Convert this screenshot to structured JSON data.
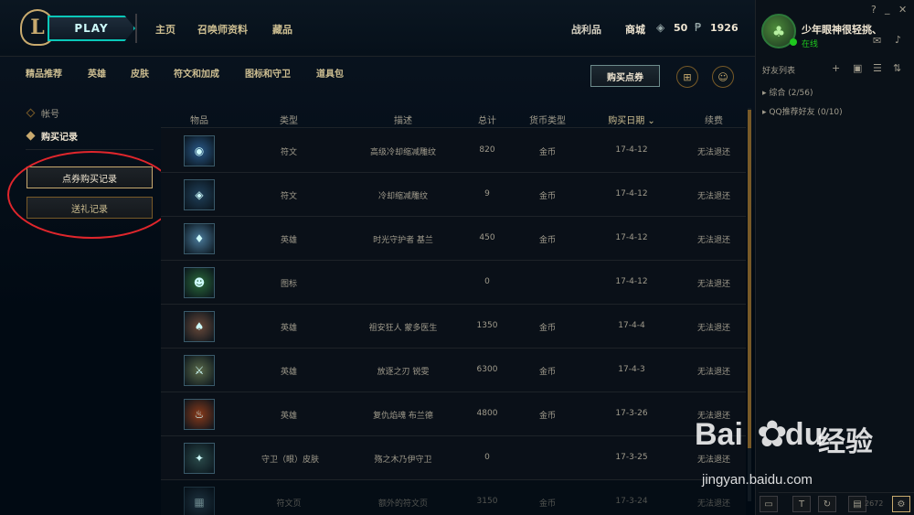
{
  "topbar": {
    "logo": "L",
    "play": "PLAY",
    "nav": [
      "主页",
      "召唤师资料",
      "藏品"
    ],
    "right_nav": [
      "战利品",
      "商城"
    ],
    "be_amount": "50",
    "rp_amount": "1926"
  },
  "subnav": [
    "精品推荐",
    "英雄",
    "皮肤",
    "符文和加成",
    "图标和守卫",
    "道具包"
  ],
  "buy_rp": "购买点券",
  "sidebar": {
    "items": [
      "帐号",
      "购买记录"
    ],
    "buttons": [
      "点券购买记录",
      "送礼记录"
    ]
  },
  "table": {
    "headers": [
      "物品",
      "类型",
      "描述",
      "总计",
      "货币类型",
      "购买日期",
      "续费"
    ],
    "sort_icon": "chevron-down-icon",
    "rows": [
      {
        "type": "符文",
        "desc": "高级冷却缩减雕纹",
        "total": "820",
        "currency": "金币",
        "date": "17-4-12",
        "refund": "无法退还",
        "thumb_color": "#2a5a8a"
      },
      {
        "type": "符文",
        "desc": "冷却缩减雕纹",
        "total": "9",
        "currency": "金币",
        "date": "17-4-12",
        "refund": "无法退还",
        "thumb_color": "#20405a"
      },
      {
        "type": "英雄",
        "desc": "时光守护者 基兰",
        "total": "450",
        "currency": "金币",
        "date": "17-4-12",
        "refund": "无法退还",
        "thumb_color": "#4a7a9a"
      },
      {
        "type": "图标",
        "desc": "",
        "total": "0",
        "currency": "",
        "date": "17-4-12",
        "refund": "无法退还",
        "thumb_color": "#2a6a3a"
      },
      {
        "type": "英雄",
        "desc": "祖安狂人 蒙多医生",
        "total": "1350",
        "currency": "金币",
        "date": "17-4-4",
        "refund": "无法退还",
        "thumb_color": "#6a4a3a"
      },
      {
        "type": "英雄",
        "desc": "放逐之刃 锐雯",
        "total": "6300",
        "currency": "金币",
        "date": "17-4-3",
        "refund": "无法退还",
        "thumb_color": "#5a6a4a"
      },
      {
        "type": "英雄",
        "desc": "复仇焰魂 布兰德",
        "total": "4800",
        "currency": "金币",
        "date": "17-3-26",
        "refund": "无法退还",
        "thumb_color": "#8a3a1a"
      },
      {
        "type": "守卫（眼）皮肤",
        "desc": "殇之木乃伊守卫",
        "total": "0",
        "currency": "",
        "date": "17-3-25",
        "refund": "无法退还",
        "thumb_color": "#2a4a4a"
      },
      {
        "type": "符文页",
        "desc": "额外的符文页",
        "total": "3150",
        "currency": "金币",
        "date": "17-3-24",
        "refund": "无法退还",
        "thumb_color": "#3a5a6a"
      }
    ]
  },
  "friends": {
    "username": "少年眼神很轻挑、",
    "status": "在线",
    "list_title": "好友列表",
    "groups": [
      "综合 (2/56)",
      "QQ推荐好友 (0/10)"
    ],
    "bottom_number": "2672"
  },
  "watermark": {
    "logo": "Bai",
    "logo2": "du",
    "cn": "经验",
    "url": "jingyan.baidu.com"
  }
}
